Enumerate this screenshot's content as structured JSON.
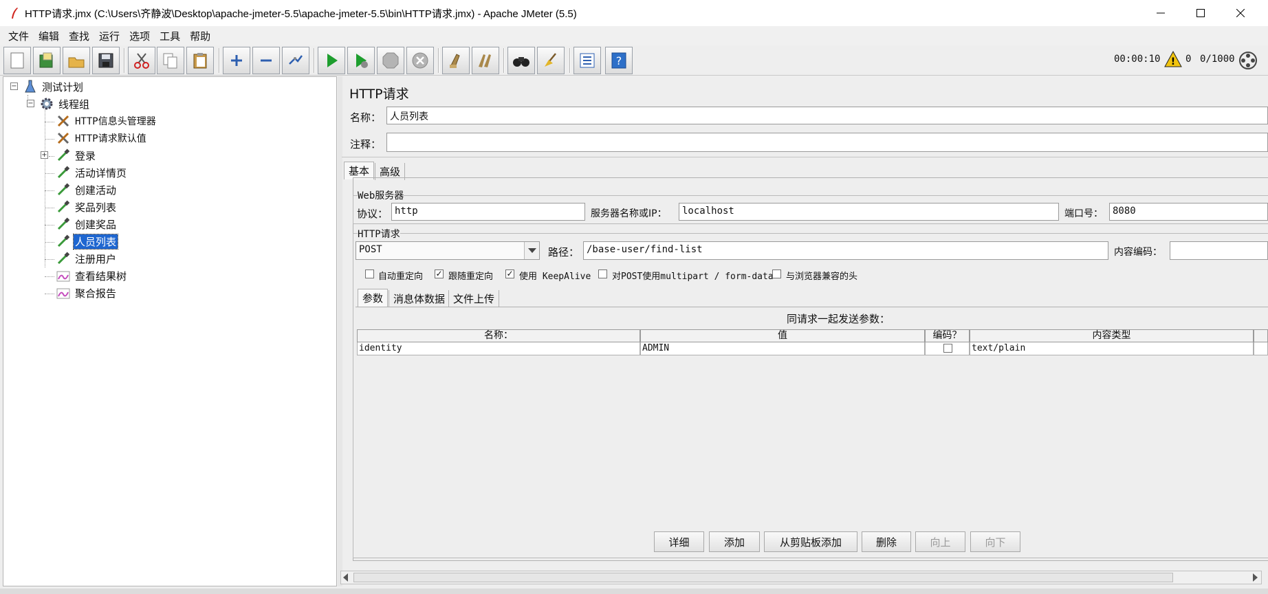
{
  "window": {
    "title": "HTTP请求.jmx (C:\\Users\\齐静波\\Desktop\\apache-jmeter-5.5\\apache-jmeter-5.5\\bin\\HTTP请求.jmx) - Apache JMeter (5.5)"
  },
  "menu": [
    "文件",
    "编辑",
    "查找",
    "运行",
    "选项",
    "工具",
    "帮助"
  ],
  "toolbar": {
    "buttons": [
      "new-icon",
      "templates-icon",
      "open-icon",
      "save-icon",
      "cut-icon",
      "copy-icon",
      "paste-icon",
      "expand-icon",
      "collapse-icon",
      "toggle-icon",
      "start-icon",
      "start-no-pause-icon",
      "stop-icon",
      "shutdown-icon",
      "clear-icon",
      "clear-all-icon",
      "search-icon",
      "reset-search-icon",
      "function-helper-icon",
      "help-icon"
    ],
    "timer": "00:00:10",
    "warnings": "0",
    "threads": "0/1000"
  },
  "tree": {
    "root": "测试计划",
    "thread_group": "线程组",
    "items": [
      "HTTP信息头管理器",
      "HTTP请求默认值",
      "登录",
      "活动详情页",
      "创建活动",
      "奖品列表",
      "创建奖品",
      "人员列表",
      "注册用户",
      "查看结果树",
      "聚合报告"
    ],
    "selected": "人员列表"
  },
  "sampler": {
    "heading": "HTTP请求",
    "name_label": "名称：",
    "name_value": "人员列表",
    "comment_label": "注释：",
    "comment_value": "",
    "tabs": [
      "基本",
      "高级"
    ],
    "web_server": {
      "legend": "Web服务器",
      "protocol_label": "协议：",
      "protocol_value": "http",
      "server_label": "服务器名称或IP：",
      "server_value": "localhost",
      "port_label": "端口号：",
      "port_value": "8080"
    },
    "http_request": {
      "legend": "HTTP请求",
      "method": "POST",
      "path_label": "路径：",
      "path_value": "/base-user/find-list",
      "encoding_label": "内容编码：",
      "encoding_value": ""
    },
    "options": [
      {
        "label": "自动重定向",
        "checked": false
      },
      {
        "label": "跟随重定向",
        "checked": true
      },
      {
        "label": "使用 KeepAlive",
        "checked": true
      },
      {
        "label": "对POST使用multipart / form-data",
        "checked": false
      },
      {
        "label": "与浏览器兼容的头",
        "checked": false
      }
    ],
    "subtabs": [
      "参数",
      "消息体数据",
      "文件上传"
    ],
    "params_caption": "同请求一起发送参数：",
    "columns": [
      "名称：",
      "值",
      "编码？",
      "内容类型"
    ],
    "rows": [
      {
        "name": "identity",
        "value": "ADMIN",
        "encode": false,
        "content_type": "text/plain"
      }
    ],
    "buttons": {
      "detail": "详细",
      "add": "添加",
      "add_clipboard": "从剪贴板添加",
      "delete": "删除",
      "up": "向上",
      "down": "向下"
    }
  }
}
